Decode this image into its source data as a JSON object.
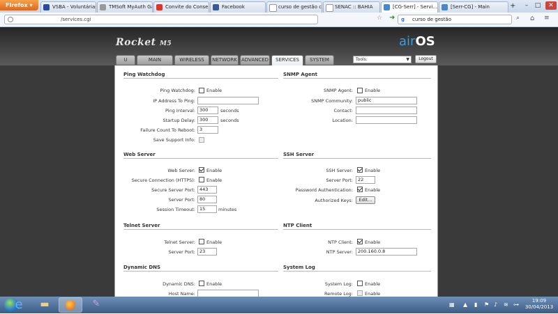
{
  "browser": {
    "app_button": "Firefox",
    "tabs": [
      {
        "label": "VSBA - Voluntárias ...",
        "icon": "pci-favicon",
        "active": false
      },
      {
        "label": "TMSoft MyAuth Ga...",
        "icon": "tmsoft-favicon",
        "active": false
      },
      {
        "label": "Convite do Consel...",
        "icon": "gmail-favicon",
        "active": false
      },
      {
        "label": "Facebook",
        "icon": "facebook-favicon",
        "active": false
      },
      {
        "label": "curso de gestão co...",
        "icon": "page-favicon",
        "active": false
      },
      {
        "label": "SENAC :: BAHIA",
        "icon": "page-favicon",
        "active": false
      },
      {
        "label": "[CG-Serr] - Servi...",
        "icon": "ubnt-favicon",
        "active": true
      },
      {
        "label": "[Serr-CG] - Main",
        "icon": "ubnt-favicon",
        "active": false
      }
    ],
    "url": "/services.cgi",
    "search": "curso de gestão"
  },
  "device": {
    "logo": "Rocket",
    "model": "M5",
    "brand_air": "air",
    "brand_os": "OS",
    "tabs": [
      "MAIN",
      "WIRELESS",
      "NETWORK",
      "ADVANCED",
      "SERVICES",
      "SYSTEM"
    ],
    "active_tab": "SERVICES",
    "tools_label": "Tools:",
    "logout": "Logout"
  },
  "ping": {
    "title": "Ping Watchdog",
    "watchdog_label": "Ping Watchdog:",
    "watchdog_enable": "Enable",
    "ip_label": "IP Address To Ping:",
    "ip_value": "",
    "interval_label": "Ping Interval:",
    "interval_value": "300",
    "interval_unit": "seconds",
    "delay_label": "Startup Delay:",
    "delay_value": "300",
    "delay_unit": "seconds",
    "failure_label": "Failure Count To Reboot:",
    "failure_value": "3",
    "save_label": "Save Support Info:"
  },
  "snmp": {
    "title": "SNMP Agent",
    "agent_label": "SNMP Agent:",
    "agent_enable": "Enable",
    "community_label": "SNMP Community:",
    "community_value": "public",
    "contact_label": "Contact:",
    "contact_value": "",
    "location_label": "Location:",
    "location_value": ""
  },
  "web": {
    "title": "Web Server",
    "server_label": "Web Server:",
    "server_enable": "Enable",
    "https_label": "Secure Connection (HTTPS):",
    "https_enable": "Enable",
    "secure_port_label": "Secure Server Port:",
    "secure_port_value": "443",
    "port_label": "Server Port:",
    "port_value": "80",
    "timeout_label": "Session Timeout:",
    "timeout_value": "15",
    "timeout_unit": "minutes"
  },
  "ssh": {
    "title": "SSH Server",
    "server_label": "SSH Server:",
    "server_enable": "Enable",
    "port_label": "Server Port:",
    "port_value": "22",
    "password_label": "Password Authentication:",
    "password_enable": "Enable",
    "keys_label": "Authorized Keys:",
    "keys_button": "Edit..."
  },
  "telnet": {
    "title": "Telnet Server",
    "server_label": "Telnet Server:",
    "server_enable": "Enable",
    "port_label": "Server Port:",
    "port_value": "23"
  },
  "ntp": {
    "title": "NTP Client",
    "client_label": "NTP Client:",
    "client_enable": "Enable",
    "server_label": "NTP Server:",
    "server_value": "200.160.0.8"
  },
  "ddns": {
    "title": "Dynamic DNS",
    "ddns_label": "Dynamic DNS:",
    "ddns_enable": "Enable",
    "host_label": "Host Name:",
    "host_value": ""
  },
  "syslog": {
    "title": "System Log",
    "log_label": "System Log:",
    "log_enable": "Enable",
    "remote_label": "Remote Log:",
    "remote_enable": "Enable"
  },
  "taskbar": {
    "time": "19:09",
    "date": "30/04/2013"
  }
}
